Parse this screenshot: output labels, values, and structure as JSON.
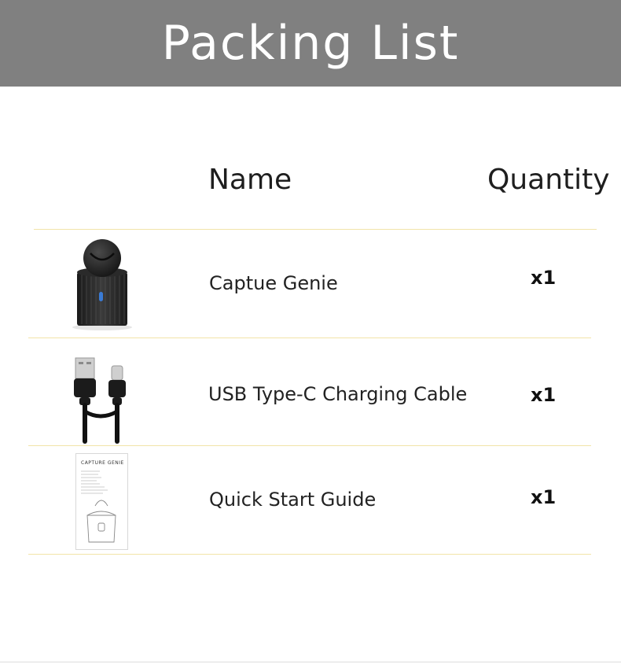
{
  "banner": {
    "title": "Packing List",
    "color": "#808080"
  },
  "columns": {
    "name": "Name",
    "quantity": "Quantity"
  },
  "divider_color": "#f2e4a8",
  "items": [
    {
      "name": "Captue Genie",
      "quantity": "x1",
      "icon": "capture-genie-device"
    },
    {
      "name": "USB Type-C Charging Cable",
      "quantity": "x1",
      "icon": "usb-c-cable"
    },
    {
      "name": "Quick Start Guide",
      "quantity": "x1",
      "icon": "quick-start-guide"
    }
  ],
  "guide_cover_text": "CAPTURE GENIE"
}
